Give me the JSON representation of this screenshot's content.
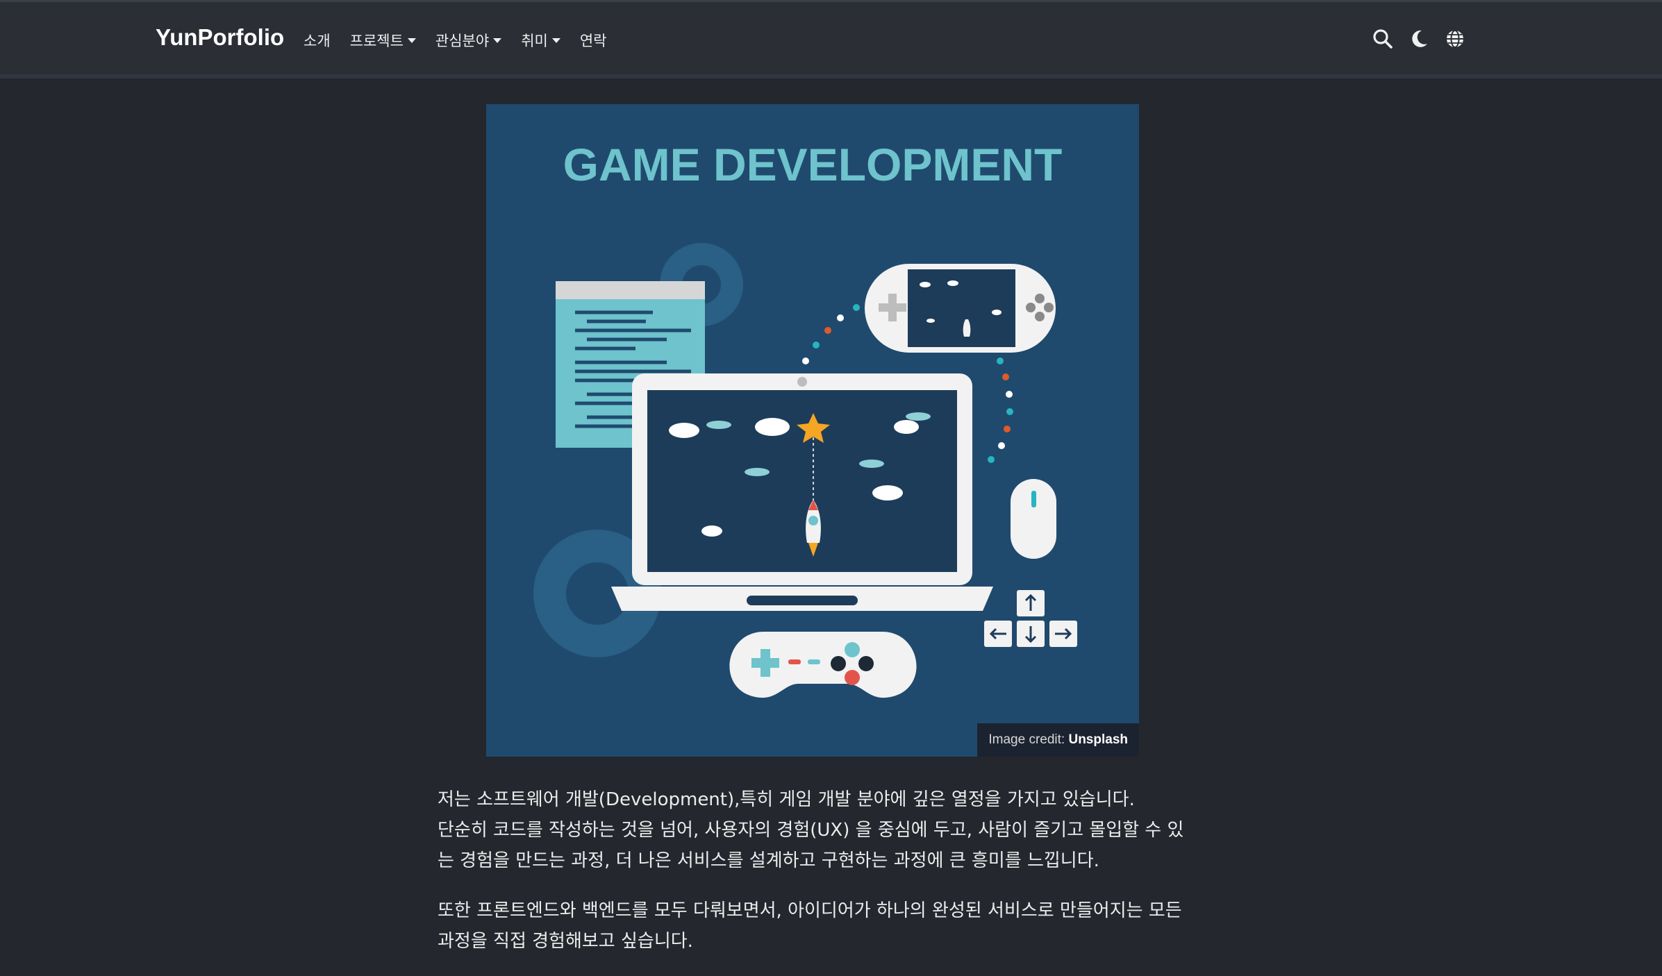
{
  "navbar": {
    "brand": "YunPorfolio",
    "menu": [
      {
        "label": "소개",
        "has_dropdown": false
      },
      {
        "label": "프로젝트",
        "has_dropdown": true
      },
      {
        "label": "관심분야",
        "has_dropdown": true
      },
      {
        "label": "취미",
        "has_dropdown": true
      },
      {
        "label": "연락",
        "has_dropdown": false
      }
    ],
    "icons": [
      "search-icon",
      "moon-icon",
      "globe-icon"
    ]
  },
  "hero_image": {
    "title": "GAME DEVELOPMENT",
    "credit_prefix": "Image credit: ",
    "credit_source": "Unsplash"
  },
  "article": {
    "paragraph1_line1": "저는 소프트웨어 개발(Development),특히 게임 개발 분야에 깊은 열정을 가지고 있습니다.",
    "paragraph1_line2": "단순히 코드를 작성하는 것을 넘어, 사용자의 경험(UX) 을 중심에 두고, 사람이 즐기고 몰입할 수 있는 경험을 만드는 과정, 더 나은 서비스를 설계하고 구현하는 과정에 큰 흥미를 느낍니다.",
    "paragraph2": "또한 프론트엔드와 백엔드를 모두 다뤄보면서, 아이디어가 하나의 완성된 서비스로 만들어지는 모든 과정을 직접 경험해보고 싶습니다."
  },
  "colors": {
    "background": "#24272e",
    "navbar": "#2b2e35",
    "hero_bg": "#1f4a6e",
    "hero_title": "#6ec3cc"
  }
}
